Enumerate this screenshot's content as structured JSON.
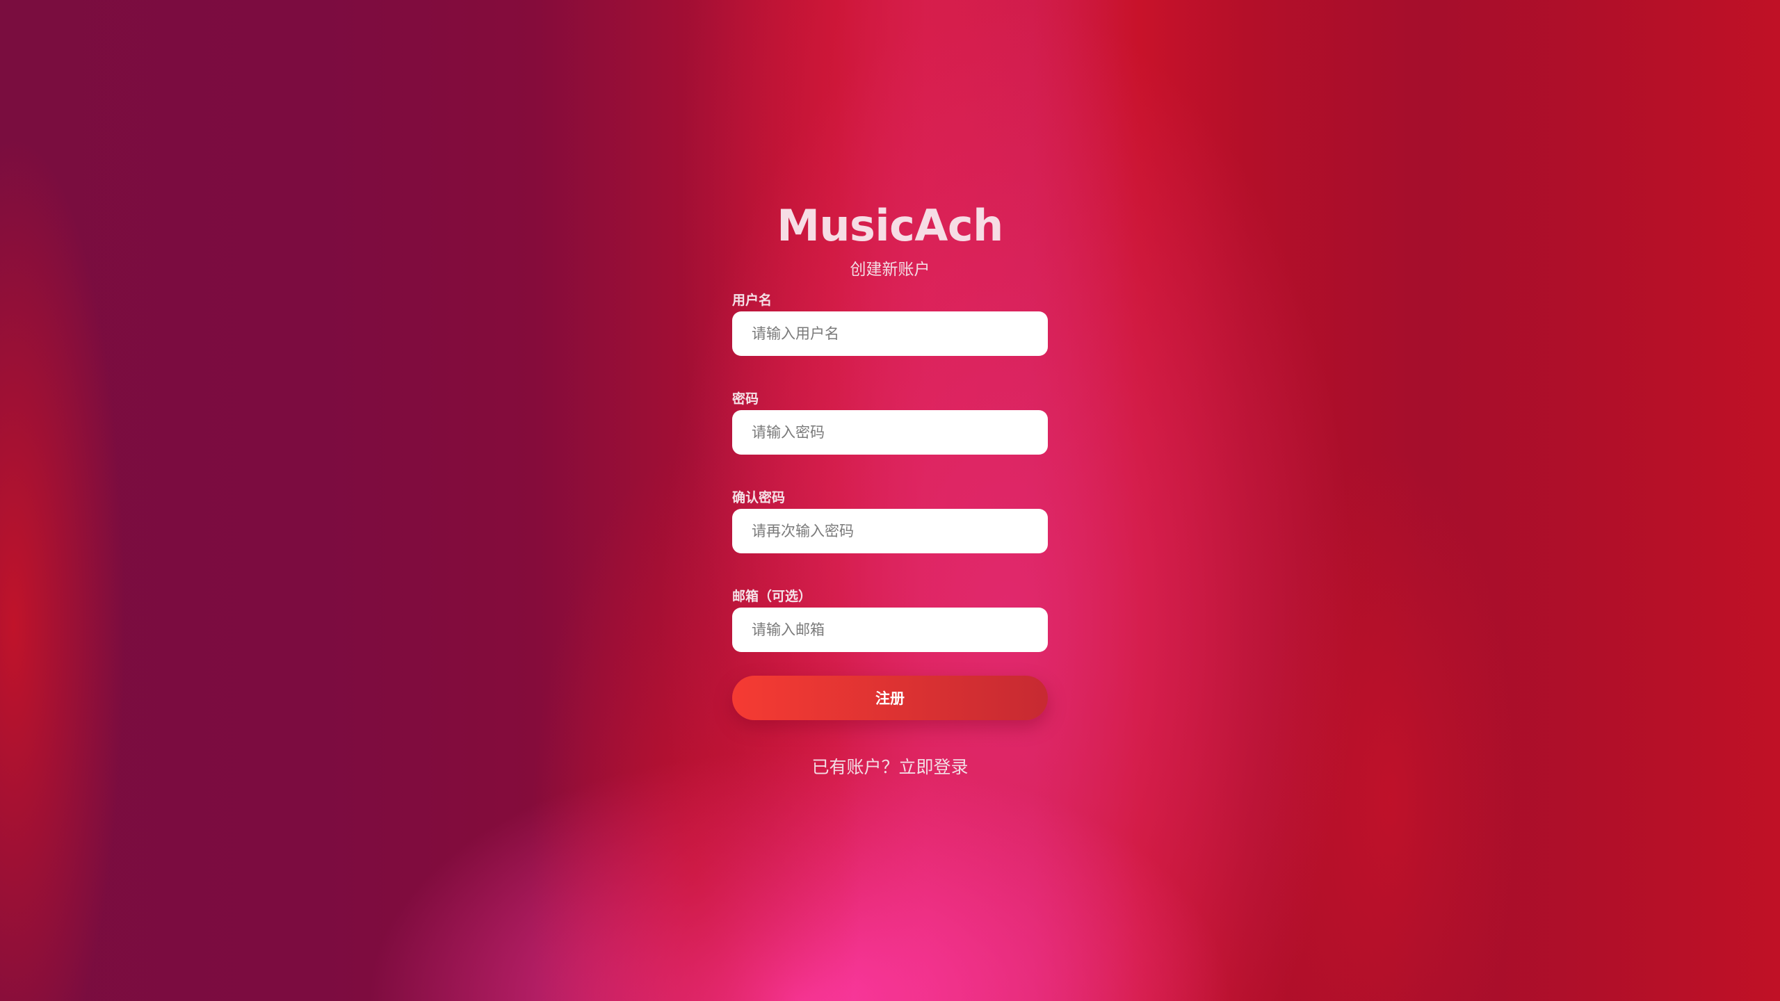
{
  "app": {
    "logo": "MusicAch",
    "subtitle": "创建新账户"
  },
  "form": {
    "fields": [
      {
        "label": "用户名",
        "placeholder": "请输入用户名",
        "type": "text"
      },
      {
        "label": "密码",
        "placeholder": "请输入密码",
        "type": "password"
      },
      {
        "label": "确认密码",
        "placeholder": "请再次输入密码",
        "type": "password"
      },
      {
        "label": "邮箱（可选）",
        "placeholder": "请输入邮箱",
        "type": "email"
      }
    ],
    "submit_label": "注册"
  },
  "footer": {
    "prompt": "已有账户？",
    "login_link": "立即登录"
  },
  "colors": {
    "button_gradient_start": "#f53b33",
    "button_gradient_end": "#c72a32",
    "text_light": "#f6dde5"
  }
}
